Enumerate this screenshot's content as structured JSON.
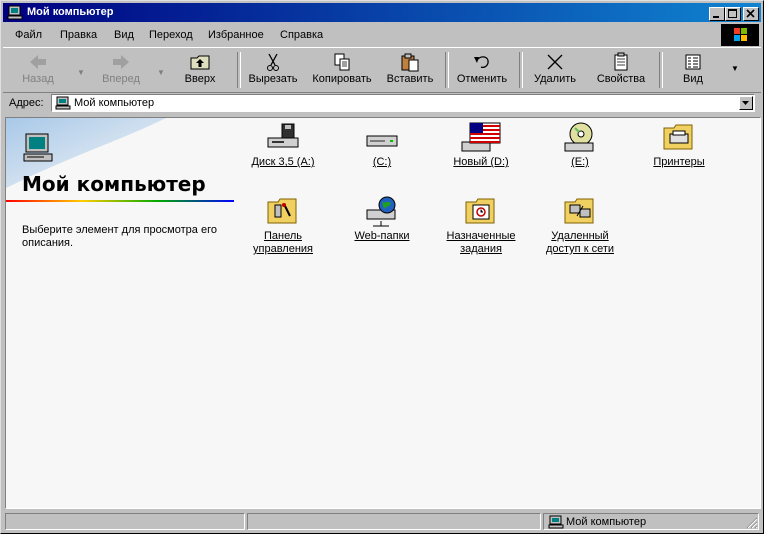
{
  "window": {
    "title": "Мой компьютер"
  },
  "menu": [
    {
      "label": "Файл"
    },
    {
      "label": "Правка"
    },
    {
      "label": "Вид"
    },
    {
      "label": "Переход"
    },
    {
      "label": "Избранное"
    },
    {
      "label": "Справка"
    }
  ],
  "toolbar": {
    "back": "Назад",
    "forward": "Вперед",
    "up": "Вверх",
    "cut": "Вырезать",
    "copy": "Копировать",
    "paste": "Вставить",
    "undo": "Отменить",
    "delete": "Удалить",
    "properties": "Свойства",
    "view": "Вид"
  },
  "address": {
    "label": "Адрес:",
    "value": "Мой компьютер"
  },
  "panel": {
    "title": "Мой компьютер",
    "description": "Выберите элемент для просмотра его описания."
  },
  "items": [
    {
      "label": "Диск 3,5 (A:)",
      "icon": "floppy-drive-icon"
    },
    {
      "label": "(C:)",
      "icon": "hard-drive-icon"
    },
    {
      "label": "Новый (D:)",
      "icon": "flag-drive-icon"
    },
    {
      "label": "(E:)",
      "icon": "cd-drive-icon"
    },
    {
      "label": "Принтеры",
      "icon": "printers-folder-icon"
    },
    {
      "label": "Панель управления",
      "icon": "control-panel-folder-icon"
    },
    {
      "label": "Web-папки",
      "icon": "web-folders-icon"
    },
    {
      "label": "Назначенные задания",
      "icon": "scheduled-tasks-folder-icon"
    },
    {
      "label": "Удаленный доступ к сети",
      "icon": "dialup-networking-folder-icon"
    }
  ],
  "status": {
    "location": "Мой компьютер"
  }
}
